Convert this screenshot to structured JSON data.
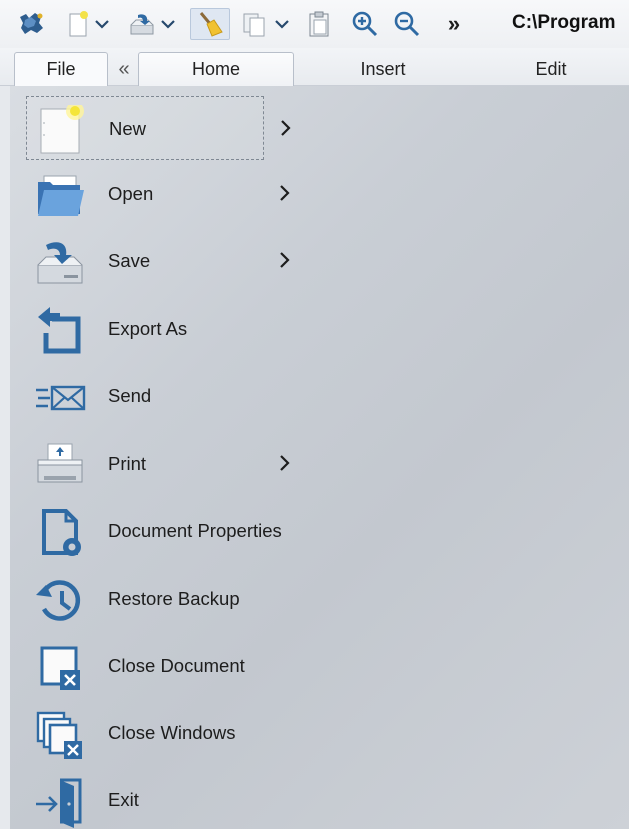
{
  "window": {
    "path_title": "C:\\Program"
  },
  "quick_access": {
    "icons": [
      "app-logo-icon",
      "new-document-icon",
      "save-tray-icon",
      "clean-broom-icon",
      "copy-pages-icon",
      "paste-clipboard-icon",
      "zoom-in-icon",
      "zoom-out-icon"
    ],
    "more_label": "»"
  },
  "ribbon": {
    "file_tab": "File",
    "collapse_label": "«",
    "tabs": [
      {
        "label": "Home"
      },
      {
        "label": "Insert"
      },
      {
        "label": "Edit"
      }
    ]
  },
  "file_menu": {
    "items": [
      {
        "label": "New",
        "icon": "new-document-icon",
        "submenu": true,
        "selected": true
      },
      {
        "label": "Open",
        "icon": "open-folder-icon",
        "submenu": true
      },
      {
        "label": "Save",
        "icon": "save-drive-icon",
        "submenu": true
      },
      {
        "label": "Export As",
        "icon": "export-arrow-icon",
        "submenu": false
      },
      {
        "label": "Send",
        "icon": "send-mail-icon",
        "submenu": false
      },
      {
        "label": "Print",
        "icon": "printer-icon",
        "submenu": true
      },
      {
        "label": "Document Properties",
        "icon": "document-settings-icon",
        "submenu": false
      },
      {
        "label": "Restore Backup",
        "icon": "restore-history-icon",
        "submenu": false
      },
      {
        "label": "Close Document",
        "icon": "close-document-icon",
        "submenu": false
      },
      {
        "label": "Close Windows",
        "icon": "close-windows-icon",
        "submenu": false
      },
      {
        "label": "Exit",
        "icon": "exit-door-icon",
        "submenu": false
      }
    ]
  },
  "colors": {
    "accent_blue": "#2f6aa3",
    "menu_bg": "#c9ced5",
    "title_text": "#111111"
  }
}
